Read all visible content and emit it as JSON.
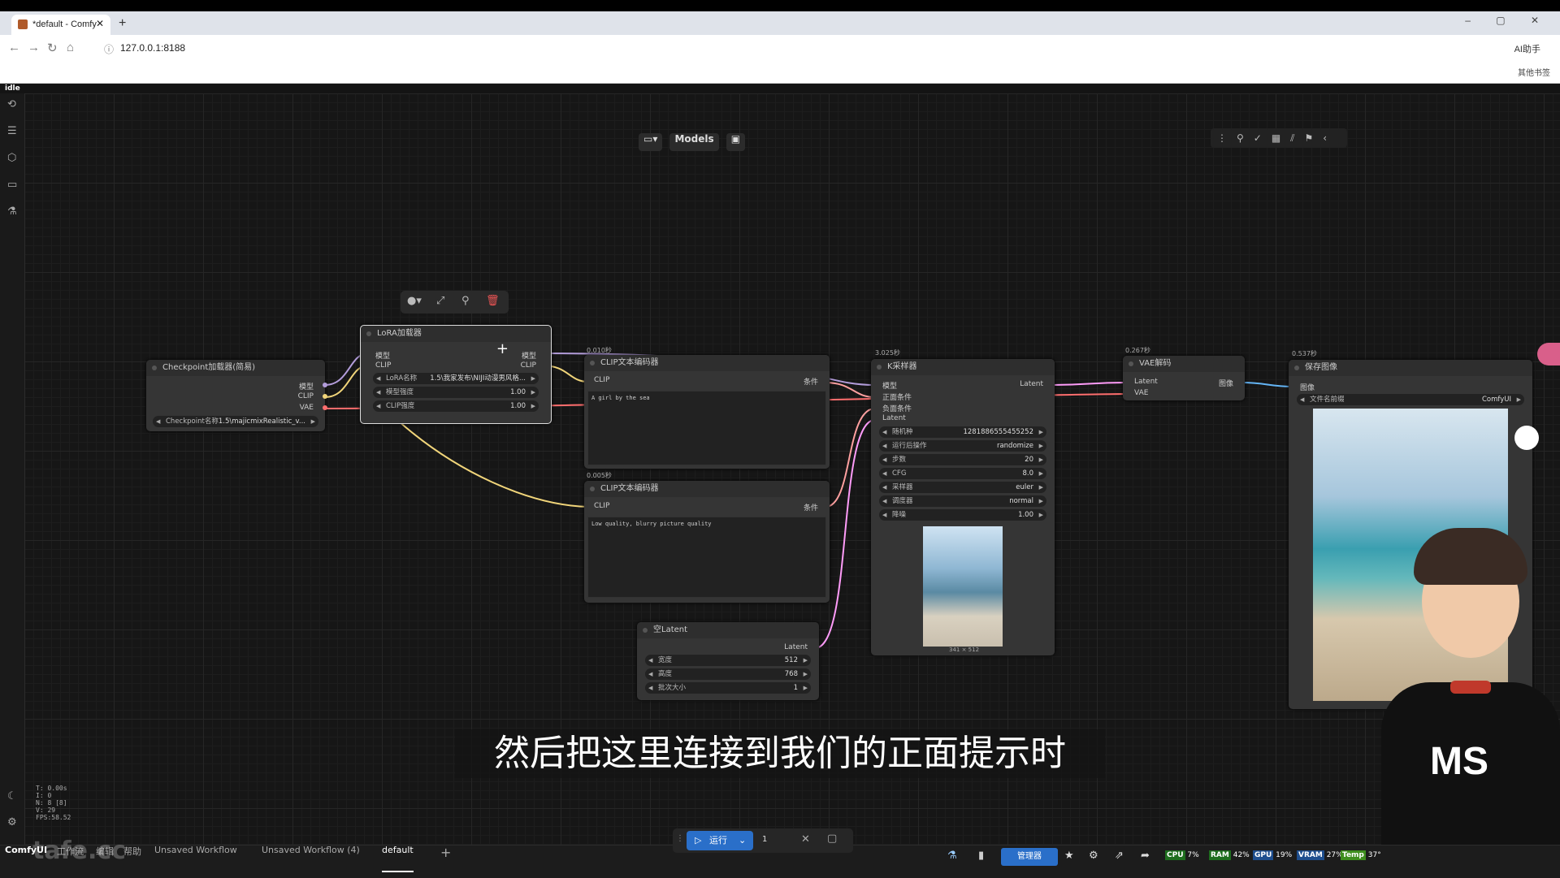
{
  "browser": {
    "tab_title": "*default - Comfy",
    "new_tab": "+",
    "window_controls": "– ▢ ✕",
    "url": "127.0.0.1:8188",
    "ai_label": "AI助手",
    "bookmarks_right": "其他书签"
  },
  "app": {
    "status": "idle",
    "toolbar": {
      "models_label": "Models"
    },
    "right_tools_icons": [
      "more-icon",
      "link-icon",
      "check-icon",
      "layout-icon",
      "chart-icon",
      "pin-icon",
      "collapse-icon"
    ]
  },
  "nodes": {
    "checkpoint": {
      "title": "Checkpoint加载器(简易)",
      "outputs": [
        "模型",
        "CLIP",
        "VAE"
      ],
      "widget_label": "Checkpoint名称",
      "widget_value": "1.5\\majicmixRealistic_v..."
    },
    "lora": {
      "title": "LoRA加载器",
      "inputs": [
        "模型",
        "CLIP"
      ],
      "outputs": [
        "模型",
        "CLIP"
      ],
      "widgets": [
        {
          "label": "LoRA名称",
          "value": "1.5\\我家发布\\NIJI动漫男风格..."
        },
        {
          "label": "模型强度",
          "value": "1.00"
        },
        {
          "label": "CLIP强度",
          "value": "1.00"
        }
      ]
    },
    "clip_pos": {
      "time": "0.010秒",
      "title": "CLIP文本编码器",
      "input": "CLIP",
      "output": "条件",
      "text": "A girl by the sea"
    },
    "clip_neg": {
      "time": "0.005秒",
      "title": "CLIP文本编码器",
      "input": "CLIP",
      "output": "条件",
      "text": "Low quality, blurry picture quality"
    },
    "latent": {
      "title": "空Latent",
      "output": "Latent",
      "widgets": [
        {
          "label": "宽度",
          "value": "512"
        },
        {
          "label": "高度",
          "value": "768"
        },
        {
          "label": "批次大小",
          "value": "1"
        }
      ]
    },
    "ksampler": {
      "time": "3.025秒",
      "title": "K采样器",
      "inputs": [
        "模型",
        "正面条件",
        "负面条件",
        "Latent"
      ],
      "output": "Latent",
      "widgets": [
        {
          "label": "随机种",
          "value": "1281886555455252"
        },
        {
          "label": "运行后操作",
          "value": "randomize"
        },
        {
          "label": "步数",
          "value": "20"
        },
        {
          "label": "CFG",
          "value": "8.0"
        },
        {
          "label": "采样器",
          "value": "euler"
        },
        {
          "label": "调度器",
          "value": "normal"
        },
        {
          "label": "降噪",
          "value": "1.00"
        }
      ],
      "preview_size": "341 × 512"
    },
    "vae": {
      "time": "0.267秒",
      "title": "VAE解码",
      "inputs": [
        "Latent",
        "VAE"
      ],
      "output": "图像"
    },
    "save": {
      "time": "0.537秒",
      "title": "保存图像",
      "input": "图像",
      "prefix_label": "文件名前缀",
      "prefix_value": "ComfyUI"
    }
  },
  "subtitle": "然后把这里连接到我们的正面提示时",
  "stats": [
    "T: 0.00s",
    "I: 0",
    "N: 8 [8]",
    "V: 29",
    "FPS:58.52"
  ],
  "bottom": {
    "logo": "ComfyUI",
    "menus": [
      "工作流",
      "编辑",
      "帮助"
    ],
    "tabs": [
      "Unsaved Workflow",
      "Unsaved Workflow (4)",
      "default"
    ],
    "run_label": "运行",
    "batch_count": "1",
    "manager_label": "管理器",
    "monitors": [
      {
        "label": "CPU",
        "value": "7%"
      },
      {
        "label": "RAM",
        "value": "42%"
      },
      {
        "label": "GPU",
        "value": "19%"
      },
      {
        "label": "VRAM",
        "value": "27%"
      },
      {
        "label": "Temp",
        "value": "37°"
      }
    ]
  },
  "watermark": "tafe.cc",
  "avatar_shirt": "MS",
  "colors": {
    "accent": "#2a6fc9",
    "link_clip": "#f1d57a",
    "link_model": "#b39ddb",
    "link_cond": "#ffa0a0",
    "link_vae": "#ff6e6e",
    "link_latent": "#ff9cf9",
    "link_image": "#64b5f6"
  }
}
